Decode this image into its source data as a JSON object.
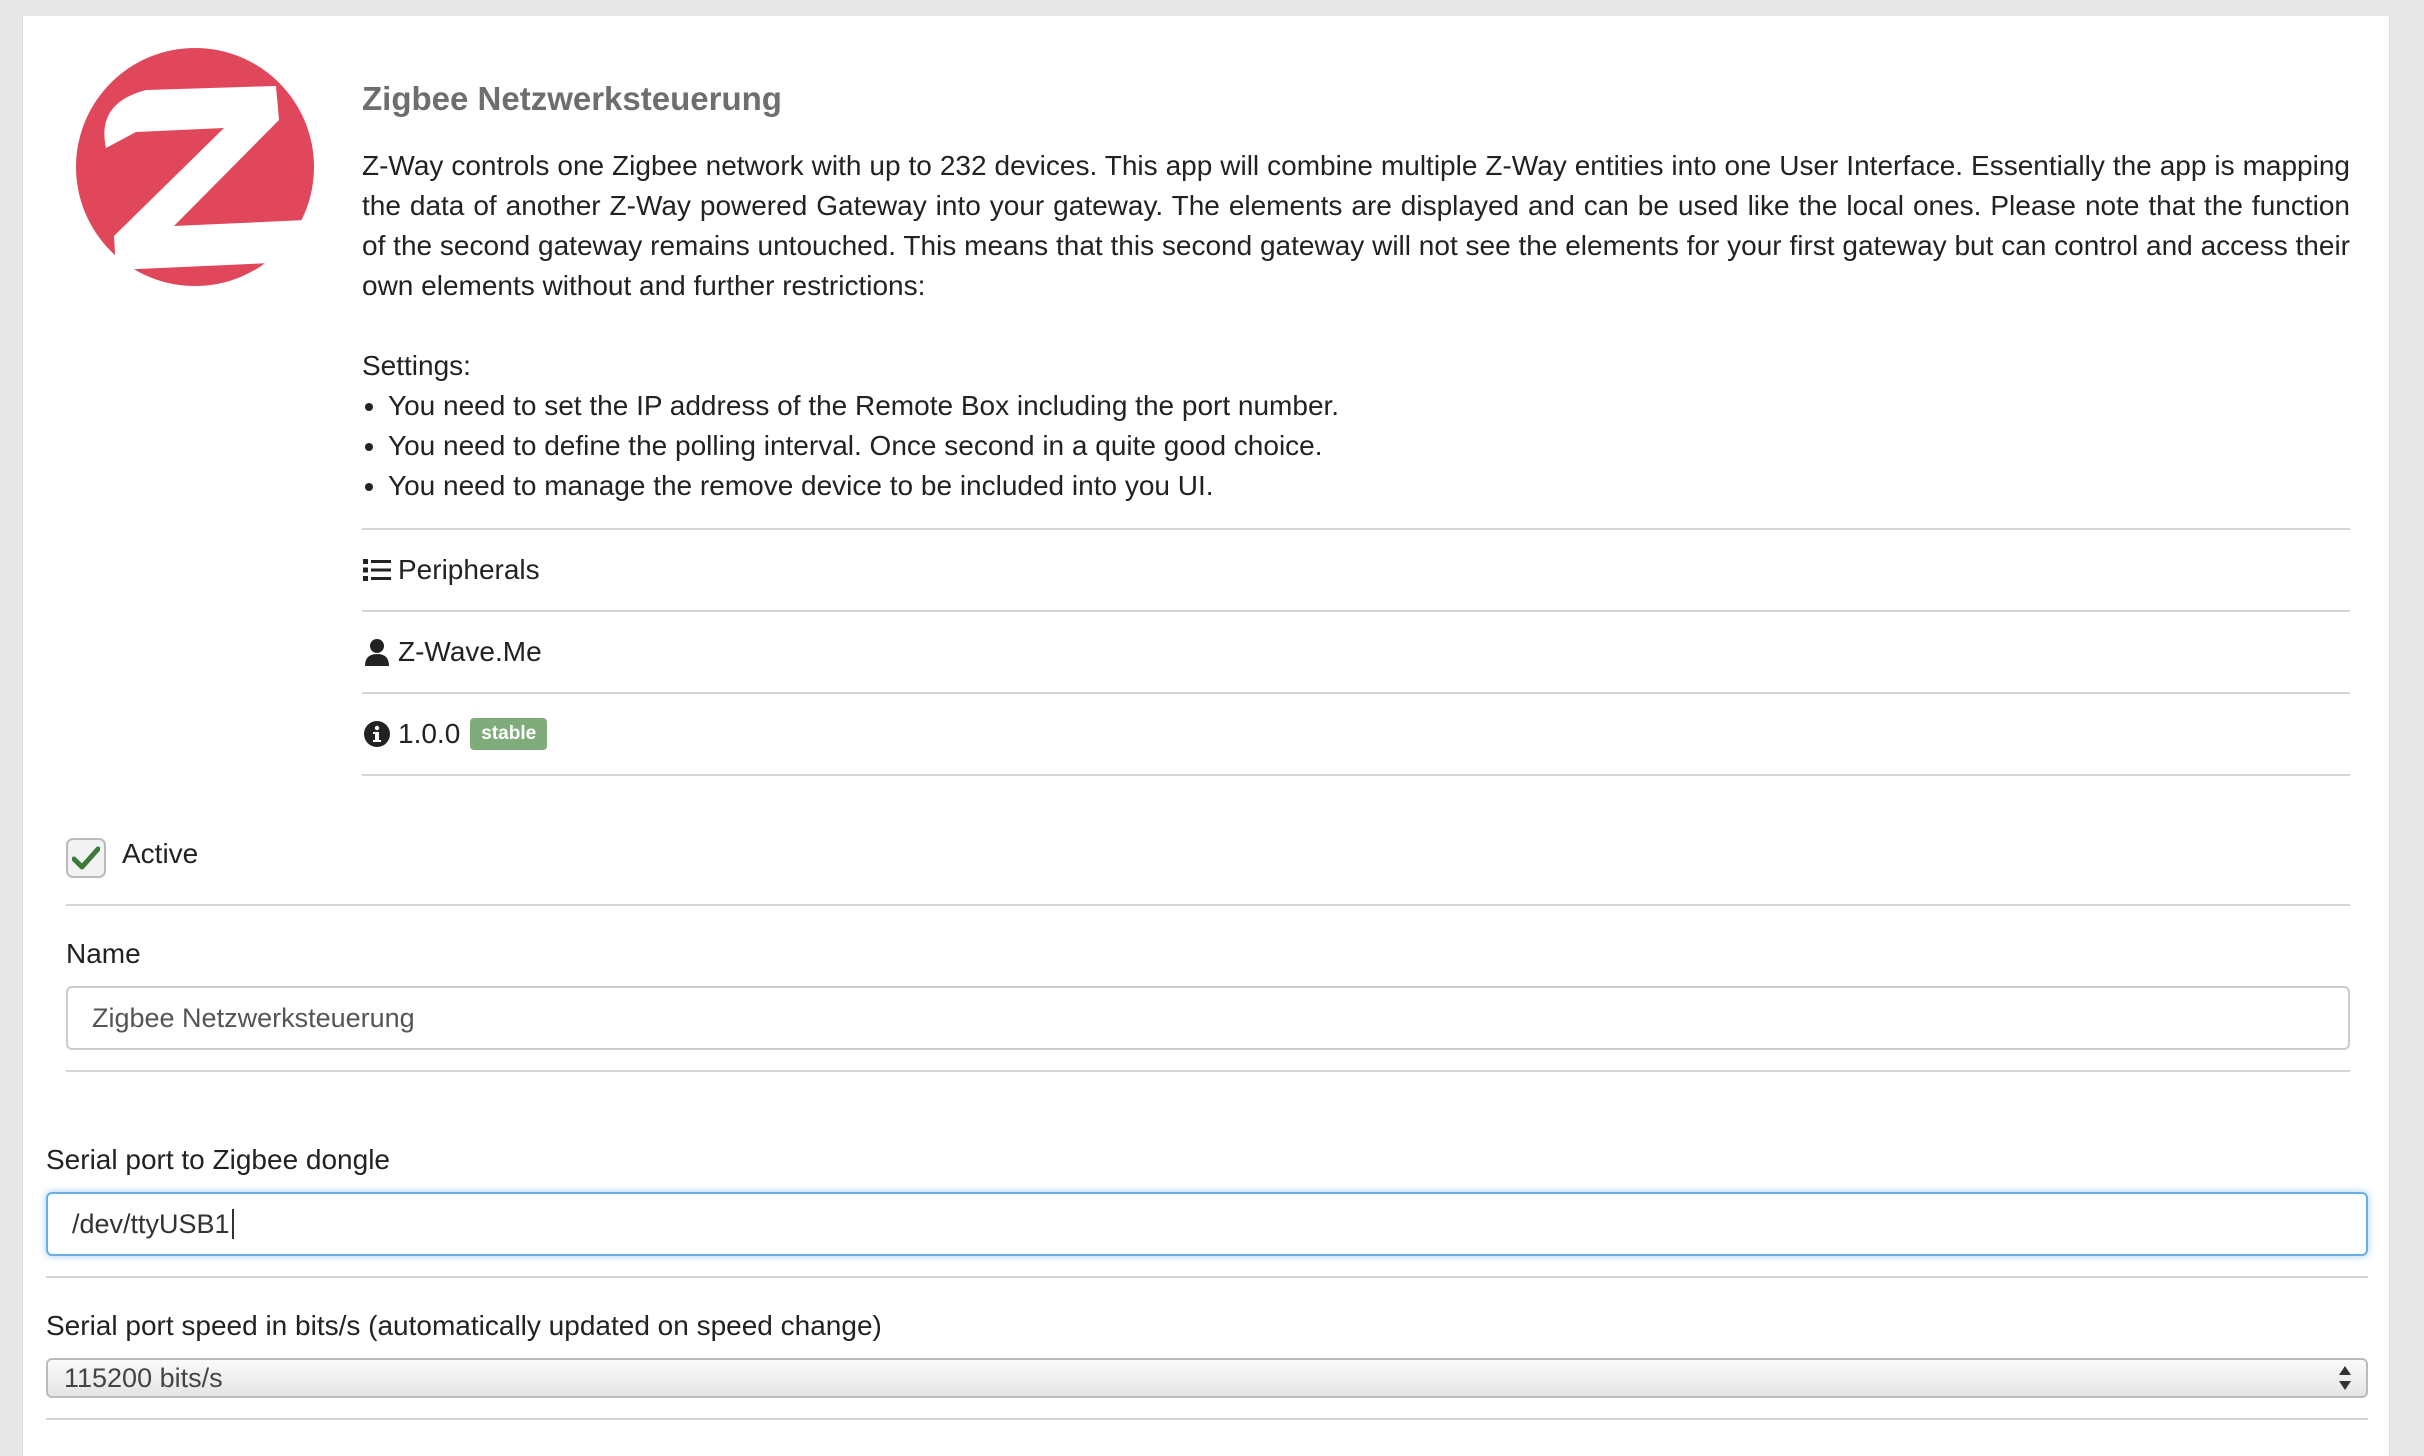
{
  "app": {
    "title": "Zigbee Netzwerksteuerung",
    "description": "Z-Way controls one Zigbee network with up to 232 devices. This app will combine multiple Z-Way entities into one User Interface. Essentially the app is mapping the data of another Z-Way powered Gateway into your gateway. The elements are displayed and can be used like the local ones. Please note that the function of the second gateway remains untouched. This means that this second gateway will not see the elements for your first gateway but can control and access their own elements without and further restrictions:",
    "settings_heading": "Settings:",
    "settings": [
      "You need to set the IP address of the Remote Box including the port number.",
      "You need to define the polling interval. Once second in a quite good choice.",
      "You need to manage the remove device to be included into you UI."
    ],
    "category": "Peripherals",
    "author": "Z-Wave.Me",
    "version": "1.0.0",
    "maturity": "stable",
    "logo_color": "#e0475b"
  },
  "form": {
    "active_label": "Active",
    "active_checked": true,
    "name_label": "Name",
    "name_value": "Zigbee Netzwerksteuerung",
    "port_label": "Serial port to Zigbee dongle",
    "port_value": "/dev/ttyUSB1",
    "speed_label": "Serial port speed in bits/s (automatically updated on speed change)",
    "speed_value": "115200 bits/s"
  },
  "colors": {
    "badge": "#7fac7a",
    "focus_border": "#66afe9",
    "check": "#3a7a3a"
  },
  "icons": {
    "category": "list-icon",
    "author": "user-icon",
    "version": "info-circle-icon",
    "active": "checkmark-icon",
    "select": "select-arrows-icon"
  }
}
